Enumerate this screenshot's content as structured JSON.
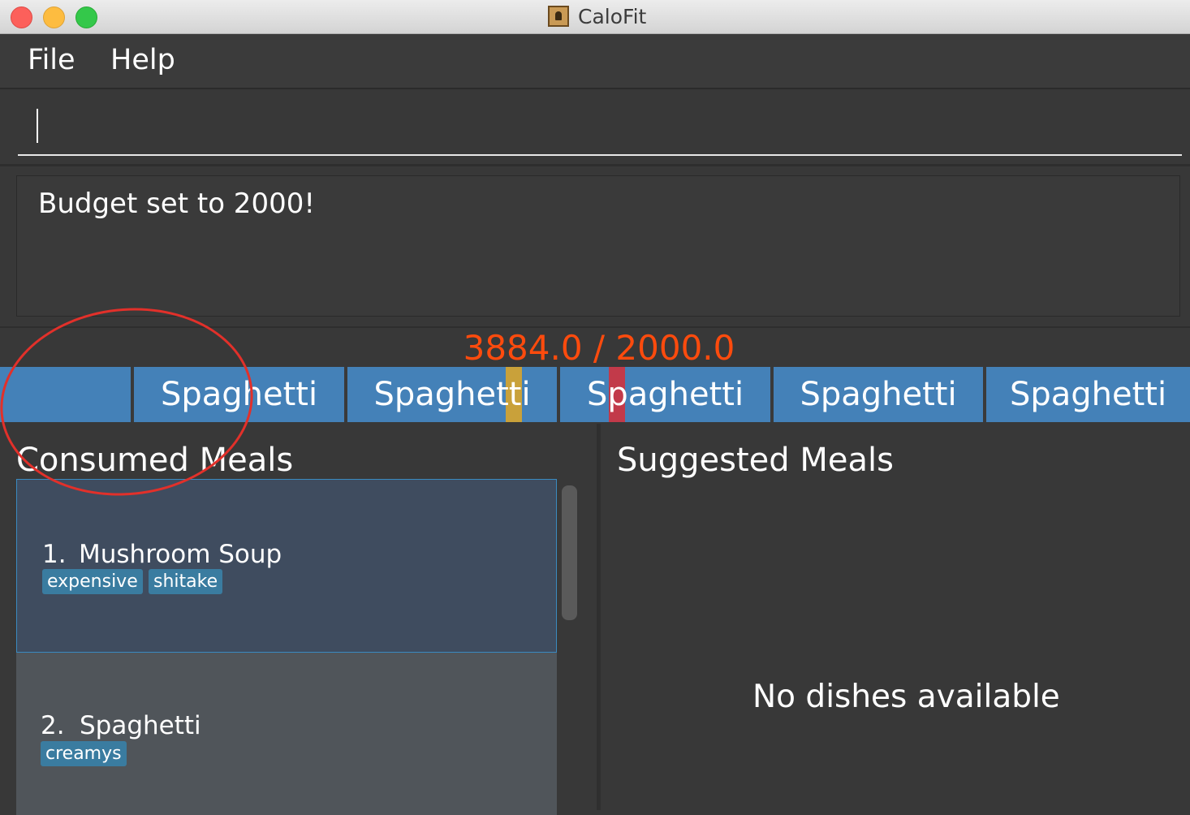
{
  "window": {
    "title": "CaloFit"
  },
  "menu": {
    "items": [
      "File",
      "Help"
    ]
  },
  "command": {
    "value": ""
  },
  "result": {
    "text": "Budget set to 2000!"
  },
  "calorie_progress": {
    "text": "3884.0 / 2000.0",
    "consumed": 3884.0,
    "budget": 2000.0,
    "color": "#ff4b0d"
  },
  "history_bar": {
    "tiles": [
      "",
      "Spaghetti",
      "Spaghetti",
      "Spaghetti",
      "Spaghetti",
      "Spaghetti"
    ],
    "tile_color": "#4481b8",
    "markers": [
      {
        "tile": 2,
        "color": "#c9a13a"
      },
      {
        "tile": 3,
        "color": "#c23a4a"
      }
    ]
  },
  "consumed": {
    "title": "Consumed Meals",
    "meals": [
      {
        "index": "1.",
        "name": "Mushroom Soup",
        "tags": [
          "expensive",
          "shitake"
        ]
      },
      {
        "index": "2.",
        "name": "Spaghetti",
        "tags": [
          "creamys"
        ]
      }
    ]
  },
  "suggested": {
    "title": "Suggested Meals",
    "empty_message": "No dishes available"
  },
  "annotation": {
    "color": "#e2302a"
  }
}
